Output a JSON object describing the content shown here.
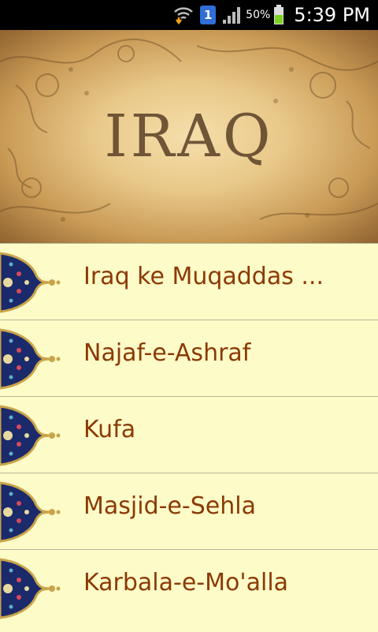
{
  "status_bar": {
    "sim_number": "1",
    "battery_percent": "50%",
    "time": "5:39 PM"
  },
  "banner": {
    "title": "IRAQ"
  },
  "list": {
    "items": [
      {
        "label": "Iraq ke Muqaddas ..."
      },
      {
        "label": "Najaf-e-Ashraf"
      },
      {
        "label": "Kufa"
      },
      {
        "label": "Masjid-e-Sehla"
      },
      {
        "label": "Karbala-e-Mo'alla"
      }
    ]
  },
  "colors": {
    "list_background": "#fdfbc8",
    "item_text": "#8b3a05",
    "divider": "#b9b89a",
    "ornament_navy": "#1b2a6b",
    "ornament_gold": "#c9a44a"
  }
}
